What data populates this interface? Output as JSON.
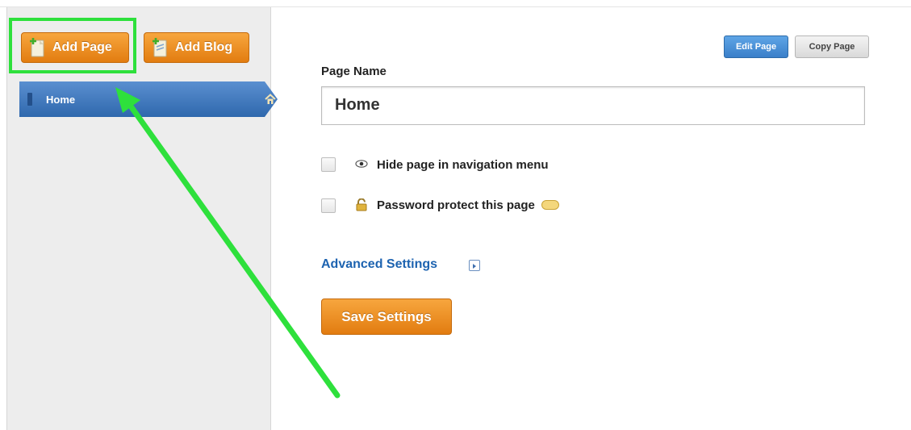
{
  "sidebar": {
    "add_page_label": "Add Page",
    "add_blog_label": "Add Blog",
    "pages": [
      {
        "label": "Home",
        "icon": "home-icon"
      }
    ]
  },
  "toolbar": {
    "edit_page_label": "Edit Page",
    "copy_page_label": "Copy Page"
  },
  "form": {
    "page_name_label": "Page Name",
    "page_name_value": "Home",
    "hide_option_label": "Hide page in navigation menu",
    "password_option_label": "Password protect this page",
    "advanced_settings_label": "Advanced Settings",
    "save_label": "Save Settings"
  },
  "colors": {
    "accent_orange": "#f39a2b",
    "nav_blue": "#3f78bf",
    "link_blue": "#1d63b0",
    "highlight_green": "#2ee03c"
  }
}
